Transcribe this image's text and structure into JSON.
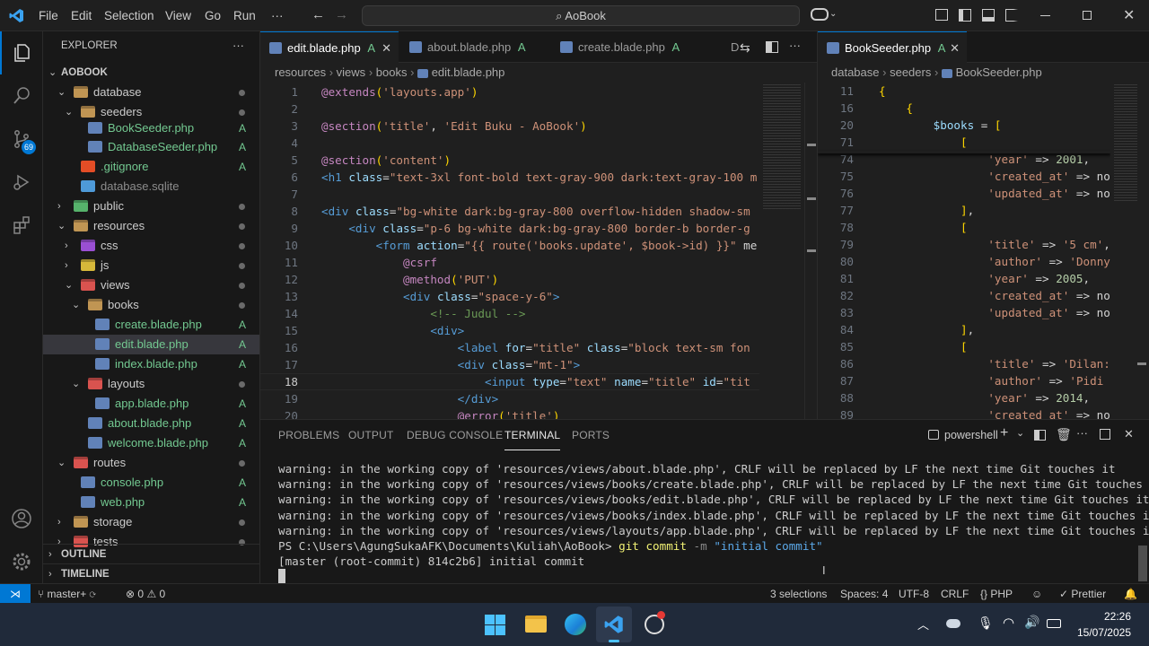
{
  "titlebar": {
    "menu": [
      "File",
      "Edit",
      "Selection",
      "View",
      "Go",
      "Run",
      "···"
    ],
    "search": "AoBook",
    "icons": [
      "vscode-logo-icon",
      "back-arrow-icon",
      "forward-arrow-icon",
      "copilot-icon",
      "layout-icon",
      "sidebar-toggle-icon",
      "panel-toggle-icon",
      "secondary-sidebar-icon",
      "minimize-icon",
      "restore-icon",
      "close-icon"
    ]
  },
  "activity": {
    "scm_badge": "69"
  },
  "sidebar": {
    "header": "EXPLORER",
    "more": "···",
    "root": "AOBOOK",
    "items": [
      {
        "label": "database",
        "badge": "",
        "dot": true
      },
      {
        "label": "seeders",
        "badge": "",
        "dot": true
      },
      {
        "label": "BookSeeder.php",
        "badge": "A",
        "dot": false
      },
      {
        "label": "DatabaseSeeder.php",
        "badge": "A",
        "dot": false
      },
      {
        "label": ".gitignore",
        "badge": "A",
        "dot": false
      },
      {
        "label": "database.sqlite",
        "badge": "",
        "dot": false
      },
      {
        "label": "public",
        "badge": "",
        "dot": true
      },
      {
        "label": "resources",
        "badge": "",
        "dot": true
      },
      {
        "label": "css",
        "badge": "",
        "dot": true
      },
      {
        "label": "js",
        "badge": "",
        "dot": true
      },
      {
        "label": "views",
        "badge": "",
        "dot": true
      },
      {
        "label": "books",
        "badge": "",
        "dot": true
      },
      {
        "label": "create.blade.php",
        "badge": "A",
        "dot": false
      },
      {
        "label": "edit.blade.php",
        "badge": "A",
        "dot": false
      },
      {
        "label": "index.blade.php",
        "badge": "A",
        "dot": false
      },
      {
        "label": "layouts",
        "badge": "",
        "dot": true
      },
      {
        "label": "app.blade.php",
        "badge": "A",
        "dot": false
      },
      {
        "label": "about.blade.php",
        "badge": "A",
        "dot": false
      },
      {
        "label": "welcome.blade.php",
        "badge": "A",
        "dot": false
      },
      {
        "label": "routes",
        "badge": "",
        "dot": true
      },
      {
        "label": "console.php",
        "badge": "A",
        "dot": false
      },
      {
        "label": "web.php",
        "badge": "A",
        "dot": false
      },
      {
        "label": "storage",
        "badge": "",
        "dot": true
      },
      {
        "label": "tests",
        "badge": "",
        "dot": true
      }
    ],
    "outline": "OUTLINE",
    "timeline": "TIMELINE"
  },
  "editor1": {
    "tabs": [
      {
        "label": "edit.blade.php",
        "badge": "A"
      },
      {
        "label": "about.blade.php",
        "badge": "A"
      },
      {
        "label": "create.blade.php",
        "badge": "A"
      },
      {
        "label": "D",
        "badge": ""
      }
    ],
    "breadcrumb": [
      "resources",
      "views",
      "books",
      "edit.blade.php"
    ],
    "line_numbers": [
      "1",
      "2",
      "3",
      "4",
      "5",
      "6",
      "7",
      "8",
      "9",
      "10",
      "11",
      "12",
      "13",
      "14",
      "15",
      "16",
      "17",
      "18",
      "19",
      "20"
    ],
    "lines": [
      "@extends('layouts.app')",
      "",
      "@section('title', 'Edit Buku - AoBook')",
      "",
      "@section('content')",
      "<h1 class=\"text-3xl font-bold text-gray-900 dark:text-gray-100 m",
      "",
      "<div class=\"bg-white dark:bg-gray-800 overflow-hidden shadow-sm",
      "    <div class=\"p-6 bg-white dark:bg-gray-800 border-b border-g",
      "        <form action=\"{{ route('books.update', $book->id) }}\" me",
      "            @csrf",
      "            @method('PUT')",
      "            <div class=\"space-y-6\">",
      "                <!-- Judul -->",
      "                <div>",
      "                    <label for=\"title\" class=\"block text-sm fon",
      "                    <div class=\"mt-1\">",
      "                        <input type=\"text\" name=\"title\" id=\"tit",
      "                    </div>",
      "                    @error('title')"
    ]
  },
  "editor2": {
    "tab": {
      "label": "BookSeeder.php",
      "badge": "A"
    },
    "breadcrumb": [
      "database",
      "seeders",
      "BookSeeder.php"
    ],
    "sticky": [
      {
        "n": "11",
        "t": "{"
      },
      {
        "n": "16",
        "t": "    {"
      },
      {
        "n": "20",
        "t": "        $books = ["
      },
      {
        "n": "71",
        "t": "            ["
      }
    ],
    "lines": [
      {
        "n": "74",
        "t": "                'year' => 2001,"
      },
      {
        "n": "75",
        "t": "                'created_at' => no"
      },
      {
        "n": "76",
        "t": "                'updated_at' => no"
      },
      {
        "n": "77",
        "t": "            ],"
      },
      {
        "n": "78",
        "t": "            ["
      },
      {
        "n": "79",
        "t": "                'title' => '5 cm',"
      },
      {
        "n": "80",
        "t": "                'author' => 'Donny"
      },
      {
        "n": "81",
        "t": "                'year' => 2005,"
      },
      {
        "n": "82",
        "t": "                'created_at' => no"
      },
      {
        "n": "83",
        "t": "                'updated_at' => no"
      },
      {
        "n": "84",
        "t": "            ],"
      },
      {
        "n": "85",
        "t": "            ["
      },
      {
        "n": "86",
        "t": "                'title' => 'Dilan:"
      },
      {
        "n": "87",
        "t": "                'author' => 'Pidi "
      },
      {
        "n": "88",
        "t": "                'year' => 2014,"
      },
      {
        "n": "89",
        "t": "                'created_at' => no"
      }
    ]
  },
  "panel": {
    "tabs": [
      "PROBLEMS",
      "OUTPUT",
      "DEBUG CONSOLE",
      "TERMINAL",
      "PORTS"
    ],
    "shell": "powershell",
    "lines": [
      "warning: in the working copy of 'resources/views/about.blade.php', CRLF will be replaced by LF the next time Git touches it",
      "warning: in the working copy of 'resources/views/books/create.blade.php', CRLF will be replaced by LF the next time Git touches it",
      "warning: in the working copy of 'resources/views/books/edit.blade.php', CRLF will be replaced by LF the next time Git touches it",
      "warning: in the working copy of 'resources/views/books/index.blade.php', CRLF will be replaced by LF the next time Git touches it",
      "warning: in the working copy of 'resources/views/layouts/app.blade.php', CRLF will be replaced by LF the next time Git touches it"
    ],
    "prompt": "PS C:\\Users\\AgungSukaAFK\\Documents\\Kuliah\\AoBook>",
    "cmd": "git commit",
    "flag": "-m",
    "arg": "\"initial commit\"",
    "result": "[master (root-commit) 814c2b6] initial commit"
  },
  "status": {
    "branch": "master+",
    "errors": "0",
    "warnings": "0",
    "selections": "3 selections",
    "spaces": "Spaces: 4",
    "encoding": "UTF-8",
    "eol": "CRLF",
    "lang": "PHP",
    "prettier": "Prettier"
  },
  "taskbar": {
    "time": "22:26",
    "date": "15/07/2025"
  }
}
